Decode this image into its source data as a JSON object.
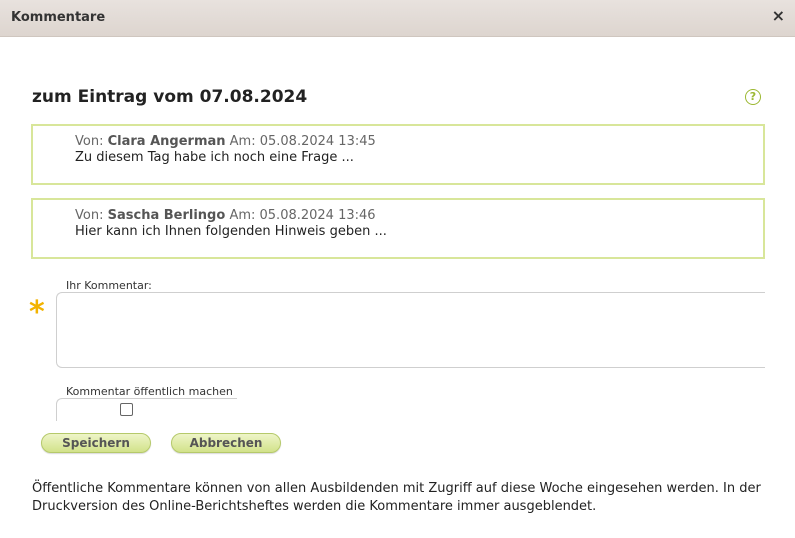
{
  "dialog": {
    "title": "Kommentare",
    "close_label": "×"
  },
  "heading": "zum Eintrag vom 07.08.2024",
  "help_label": "?",
  "comments": [
    {
      "from_label": "Von:",
      "author": "Clara Angerman",
      "date_label": "Am:",
      "datetime": "05.08.2024 13:45",
      "text": "Zu diesem Tag habe ich noch eine Frage ..."
    },
    {
      "from_label": "Von:",
      "author": "Sascha Berlingo",
      "date_label": "Am:",
      "datetime": "05.08.2024 13:46",
      "text": "Hier kann ich Ihnen folgenden Hinweis geben ..."
    }
  ],
  "form": {
    "comment_label": "Ihr Kommentar:",
    "comment_value": "",
    "required_marker": "*",
    "public_label": "Kommentar öffentlich machen",
    "public_checked": false,
    "save_label": "Speichern",
    "cancel_label": "Abbrechen"
  },
  "footer_note": "Öffentliche Kommentare können von allen Ausbildenden mit Zugriff auf diese Woche eingesehen werden. In der Druckversion des Online-Berichtsheftes werden die Kommentare immer ausgeblendet.",
  "colors": {
    "accent_green": "#d8e69a",
    "required_yellow": "#f2b300",
    "help_green": "#9cb832"
  }
}
